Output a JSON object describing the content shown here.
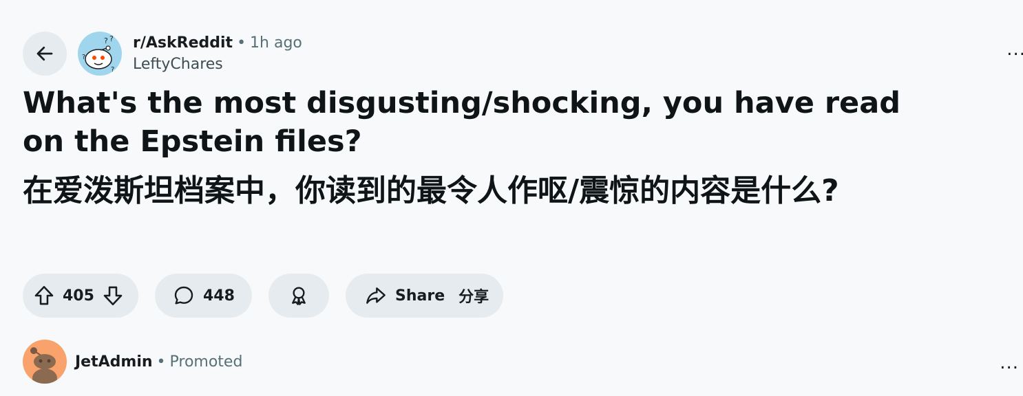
{
  "post": {
    "subreddit": "r/AskReddit",
    "separator": "•",
    "time_ago": "1h ago",
    "author": "LeftyChares",
    "title": "What's the most disgusting/shocking, you have read on the Epstein files?",
    "title_translation": "在爱泼斯坦档案中，你读到的最令人作呕/震惊的内容是什么?",
    "overflow_label": "..."
  },
  "actions": {
    "vote_count": "405",
    "comment_count": "448",
    "share_label": "Share",
    "share_translation": "分享"
  },
  "promoted": {
    "name": "JetAdmin",
    "separator": "•",
    "tag": "Promoted",
    "overflow_label": "..."
  },
  "icons": {
    "back": "arrow-left-icon",
    "upvote": "arrow-up-icon",
    "downvote": "arrow-down-icon",
    "comment": "speech-bubble-icon",
    "award": "award-icon",
    "share": "share-arrow-icon"
  }
}
